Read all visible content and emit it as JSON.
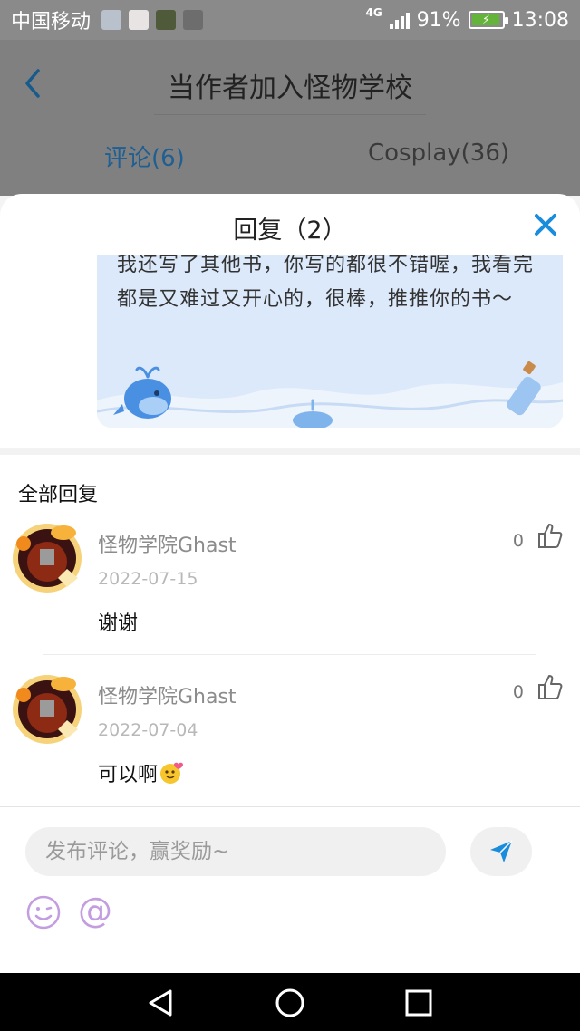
{
  "status_bar": {
    "carrier": "中国移动",
    "network": "4G",
    "battery": "91%",
    "time": "13:08",
    "notification_icons": [
      "image-icon",
      "app-icon",
      "game-icon",
      "photo-icon"
    ]
  },
  "header": {
    "title": "当作者加入怪物学校",
    "back_icon": "chevron-left-icon"
  },
  "tabs": [
    {
      "label": "评论(6)",
      "active": true
    },
    {
      "label": "Cosplay(36)",
      "active": false
    }
  ],
  "sheet": {
    "title": "回复（2）",
    "close_icon": "close-icon"
  },
  "original_comment": {
    "text": "我还写了其他书，你写的都很不错喔，我看完都是又难过又开心的，很棒，推推你的书～"
  },
  "section": {
    "title": "全部回复"
  },
  "replies": [
    {
      "name": "怪物学院Ghast",
      "date": "2022-07-15",
      "text": "谢谢",
      "likes": "0",
      "emoji": ""
    },
    {
      "name": "怪物学院Ghast",
      "date": "2022-07-04",
      "text": "可以啊",
      "likes": "0",
      "emoji": "hug-emoji-icon"
    }
  ],
  "composer": {
    "placeholder": "发布评论，赢奖励~",
    "at_symbol": "@",
    "send_icon": "send-icon",
    "emoji_icon": "smiley-icon"
  },
  "colors": {
    "accent": "#1a8cdc",
    "bubble_bg": "#dce9fa",
    "at_color": "#c39de0"
  }
}
